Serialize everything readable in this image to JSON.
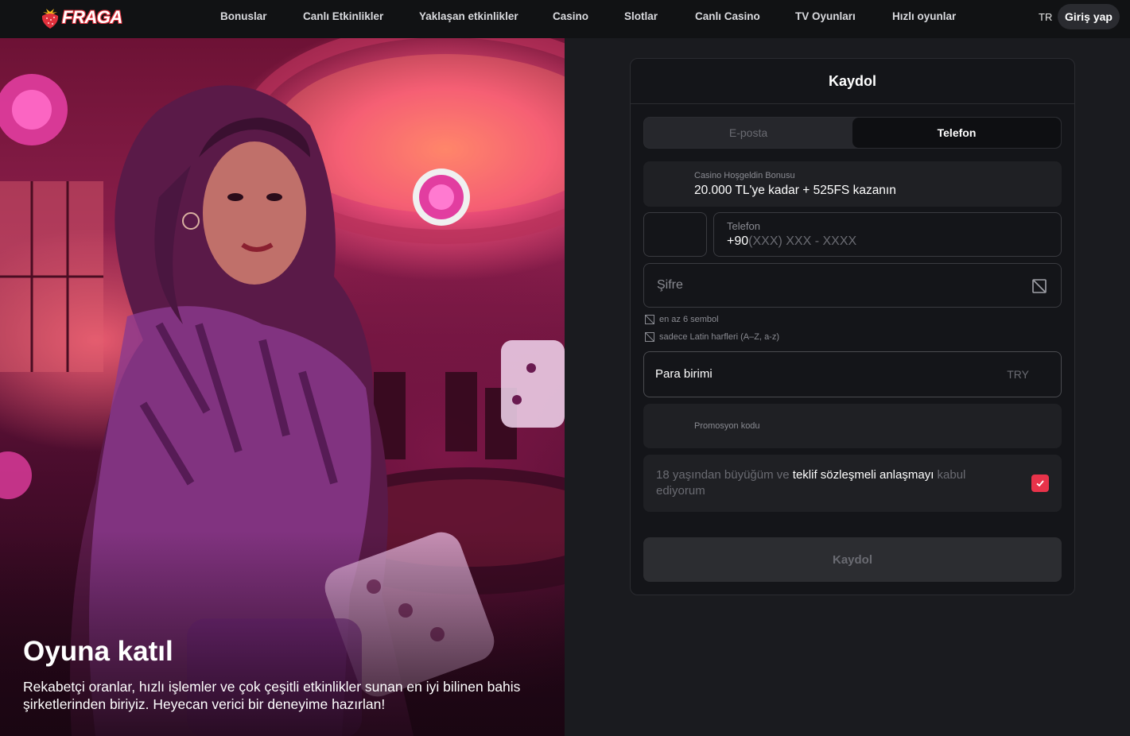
{
  "header": {
    "logo_text": "FRAGA",
    "nav": [
      {
        "label": "Bonuslar"
      },
      {
        "label": "Canlı Etkinlikler"
      },
      {
        "label": "Yaklaşan etkinlikler"
      },
      {
        "label": "Casino"
      },
      {
        "label": "Slotlar"
      },
      {
        "label": "Canlı Casino"
      },
      {
        "label": "TV Oyunları"
      },
      {
        "label": "Hızlı oyunlar"
      }
    ],
    "language": "TR",
    "login_label": "Giriş yap"
  },
  "hero": {
    "title": "Oyuna katıl",
    "text": "Rekabetçi oranlar, hızlı işlemler ve çok çeşitli etkinlikler sunan en iyi bilinen bahis şirketlerinden biriyiz. Heyecan verici bir deneyime hazırlan!"
  },
  "form": {
    "title": "Kaydol",
    "tabs": [
      {
        "label": "E-posta",
        "active": false
      },
      {
        "label": "Telefon",
        "active": true
      }
    ],
    "bonus": {
      "label": "Casino Hoşgeldin Bonusu",
      "value": "20.000 TL'ye kadar + 525FS kazanın"
    },
    "phone": {
      "label": "Telefon",
      "prefix": "+90",
      "mask": "(XXX) XXX - XXXX"
    },
    "password": {
      "placeholder": "Şifre",
      "rules": [
        "en az 6 sembol",
        "sadece Latin harfleri (A–Z, a-z)"
      ]
    },
    "currency": {
      "label": "Para birimi",
      "value": "TRY"
    },
    "promo": {
      "label": "Promosyon kodu"
    },
    "terms": {
      "before": "18 yaşından büyüğüm ve ",
      "link": "teklif sözleşmeli anlaşmayı",
      "after": " kabul ediyorum",
      "checked": true
    },
    "submit_label": "Kaydol"
  },
  "colors": {
    "accent": "#e8334a",
    "background": "#1a1b1f",
    "card": "#141519",
    "header": "#111214"
  }
}
